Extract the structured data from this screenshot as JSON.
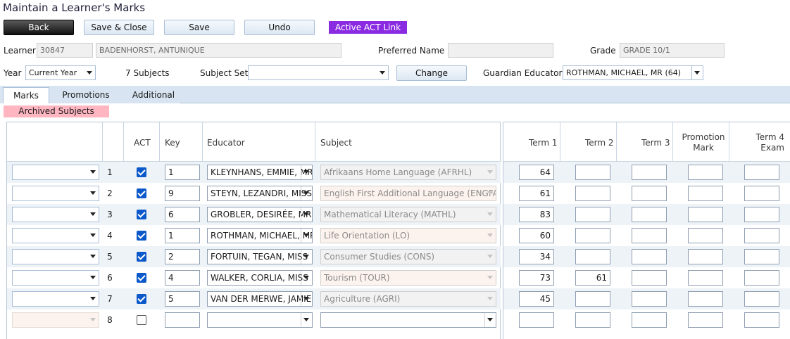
{
  "title": "Maintain a Learner's Marks",
  "toolbar": {
    "back": "Back",
    "save_close": "Save & Close",
    "save": "Save",
    "undo": "Undo",
    "act_link": "Active ACT Link"
  },
  "learner": {
    "label": "Learner",
    "id": "30847",
    "name": "BADENHORST, ANTUNIQUE",
    "preferred_label": "Preferred Name",
    "preferred_value": "",
    "grade_label": "Grade",
    "grade_value": "GRADE 10/1"
  },
  "filters": {
    "year_label": "Year",
    "year_value": "Current Year",
    "subjects_count": "7 Subjects",
    "subject_set_label": "Subject Set",
    "subject_set_value": "",
    "change": "Change",
    "guardian_label": "Guardian Educator",
    "guardian_value": "ROTHMAN, MICHAEL, MR (64)"
  },
  "tabs": [
    {
      "label": "Marks"
    },
    {
      "label": "Promotions"
    },
    {
      "label": "Additional"
    }
  ],
  "archived_label": "Archived Subjects",
  "columns": {
    "act": "ACT",
    "key": "Key",
    "educator": "Educator",
    "subject": "Subject",
    "term1": "Term 1",
    "term2": "Term 2",
    "term3": "Term 3",
    "promotion_line1": "Promotion",
    "promotion_line2": "Mark",
    "term4_line1": "Term 4",
    "term4_line2": "Exam"
  },
  "rows": [
    {
      "num": "1",
      "act": true,
      "key": "1",
      "educator": "KLEYNHANS, EMMIE, MRS",
      "subject": "Afrikaans Home Language (AFRHL)",
      "subject_pink": false,
      "term1": "64",
      "term2": "",
      "term3": "",
      "promotion": "",
      "term4": ""
    },
    {
      "num": "2",
      "act": true,
      "key": "9",
      "educator": "STEYN, LEZANDRI, MISS",
      "subject": "English First Additional Language (ENGFA)",
      "subject_pink": true,
      "term1": "61",
      "term2": "",
      "term3": "",
      "promotion": "",
      "term4": ""
    },
    {
      "num": "3",
      "act": true,
      "key": "6",
      "educator": "GROBLER, DESIRÉE, MRS",
      "subject": "Mathematical Literacy (MATHL)",
      "subject_pink": false,
      "term1": "83",
      "term2": "",
      "term3": "",
      "promotion": "",
      "term4": ""
    },
    {
      "num": "4",
      "act": true,
      "key": "1",
      "educator": "ROTHMAN, MICHAEL, MR",
      "subject": "Life Orientation (LO)",
      "subject_pink": true,
      "term1": "60",
      "term2": "",
      "term3": "",
      "promotion": "",
      "term4": ""
    },
    {
      "num": "5",
      "act": true,
      "key": "2",
      "educator": "FORTUIN, TEGAN, MISS",
      "subject": "Consumer Studies (CONS)",
      "subject_pink": false,
      "term1": "34",
      "term2": "",
      "term3": "",
      "promotion": "",
      "term4": ""
    },
    {
      "num": "6",
      "act": true,
      "key": "4",
      "educator": "WALKER, CORLIA, MISS",
      "subject": "Tourism (TOUR)",
      "subject_pink": true,
      "term1": "73",
      "term2": "61",
      "term3": "",
      "promotion": "",
      "term4": ""
    },
    {
      "num": "7",
      "act": true,
      "key": "5",
      "educator": "VAN DER MERWE, JAMIE",
      "subject": "Agriculture (AGRI)",
      "subject_pink": false,
      "term1": "45",
      "term2": "",
      "term3": "",
      "promotion": "",
      "term4": ""
    },
    {
      "num": "8",
      "act": false,
      "key": "",
      "educator": "",
      "subject": "",
      "subject_pink": false,
      "term1": "",
      "term2": "",
      "term3": "",
      "promotion": "",
      "term4": ""
    }
  ]
}
